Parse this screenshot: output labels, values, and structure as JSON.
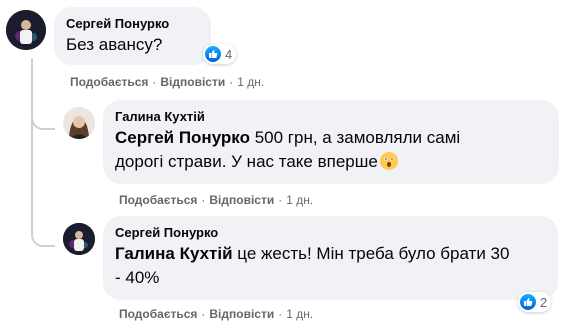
{
  "comments": [
    {
      "author": "Сергей Понурко",
      "text": "Без авансу?",
      "reaction_count": "4",
      "actions": {
        "like": "Подобається",
        "reply": "Відповісти",
        "time": "1 дн."
      }
    },
    {
      "author": "Галина Кухтій",
      "mention": "Сергей Понурко",
      "text_line1": " 500 грн, а замовляли самі",
      "text_line2": "дорогі страви. У нас таке вперше",
      "actions": {
        "like": "Подобається",
        "reply": "Відповісти",
        "time": "1 дн."
      }
    },
    {
      "author": "Сергей Понурко",
      "mention": "Галина Кухтій",
      "text_line1": " це жесть! Мін треба було брати 30",
      "text_line2": "- 40%",
      "reaction_count": "2",
      "actions": {
        "like": "Подобається",
        "reply": "Відповісти",
        "time": "1 дн."
      }
    }
  ],
  "separator": "·",
  "colors": {
    "bubble": "#f0f2f5",
    "meta": "#65676b",
    "like_blue": "#0571ed"
  }
}
